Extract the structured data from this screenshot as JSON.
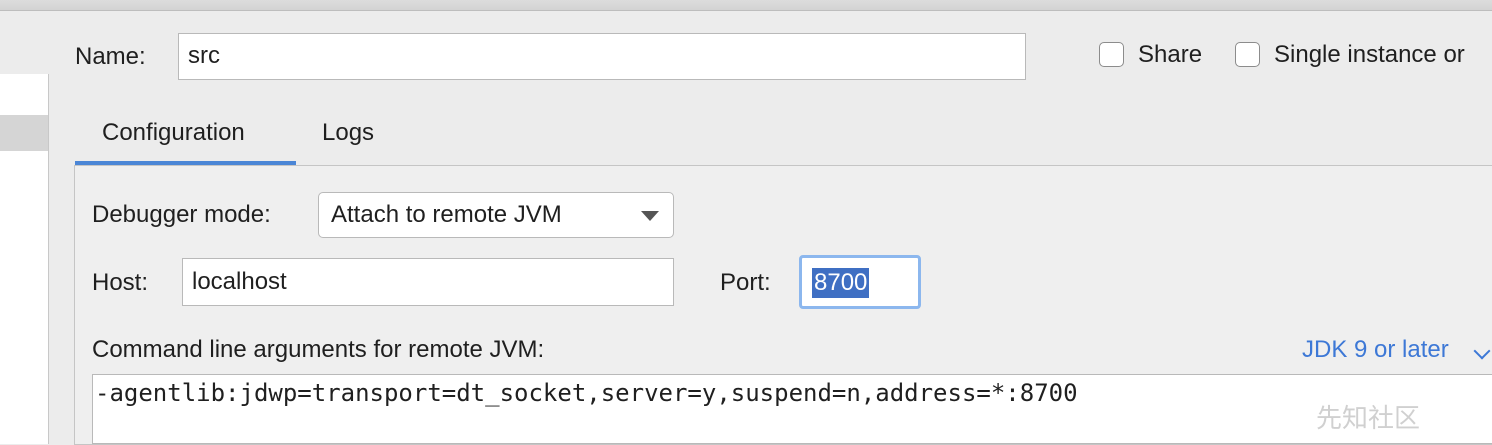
{
  "form": {
    "name_label": "Name:",
    "name_value": "src",
    "share_label": "Share",
    "single_instance_label": "Single instance or"
  },
  "tabs": [
    {
      "label": "Configuration",
      "active": true
    },
    {
      "label": "Logs",
      "active": false
    }
  ],
  "config": {
    "debugger_mode_label": "Debugger mode:",
    "debugger_mode_value": "Attach to remote JVM",
    "host_label": "Host:",
    "host_value": "localhost",
    "port_label": "Port:",
    "port_value": "8700",
    "cmdline_label": "Command line arguments for remote JVM:",
    "jdk_link": "JDK 9 or later",
    "cmdline_value": "-agentlib:jdwp=transport=dt_socket,server=y,suspend=n,address=*:8700"
  },
  "watermark": "先知社区",
  "colors": {
    "accent": "#4b86d6",
    "selection": "#3f6fc3",
    "link": "#3d78d6",
    "focus_ring": "#8cb7ee",
    "background": "#ececec"
  }
}
